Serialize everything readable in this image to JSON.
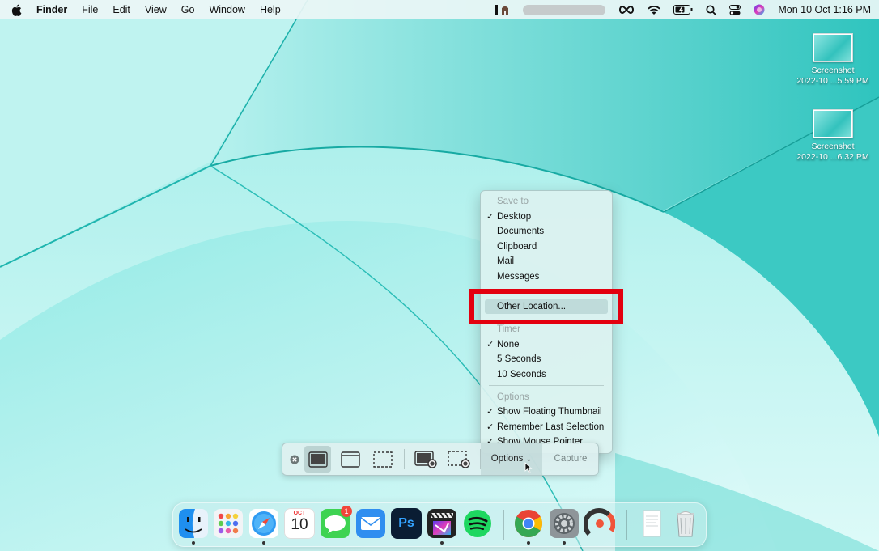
{
  "menubar": {
    "app_name": "Finder",
    "menus": [
      "File",
      "Edit",
      "View",
      "Go",
      "Window",
      "Help"
    ],
    "clock": "Mon 10 Oct  1:16 PM"
  },
  "desktop_icons": [
    {
      "name": "Screenshot",
      "date": "2022-10 ...5.59 PM"
    },
    {
      "name": "Screenshot",
      "date": "2022-10 ...6.32 PM"
    }
  ],
  "options_menu": {
    "save_header": "Save to",
    "save_items": [
      "Desktop",
      "Documents",
      "Clipboard",
      "Mail",
      "Messages"
    ],
    "highlighted_item": "Other Location...",
    "timer_header": "Timer",
    "timer_items": [
      "None",
      "5 Seconds",
      "10 Seconds"
    ],
    "options_header": "Options",
    "option_items": [
      "Show Floating Thumbnail",
      "Remember Last Selection",
      "Show Mouse Pointer"
    ]
  },
  "toolbar": {
    "options_label": "Options",
    "capture_label": "Capture"
  },
  "dock": {
    "calendar_month": "OCT",
    "calendar_day": "10",
    "messages_badge": "1",
    "photoshop_label": "Ps"
  },
  "colors": {
    "highlight_border": "#e3000f",
    "wallpaper_base": "#3fd3cf",
    "menu_bg": "#dcf2f0"
  }
}
